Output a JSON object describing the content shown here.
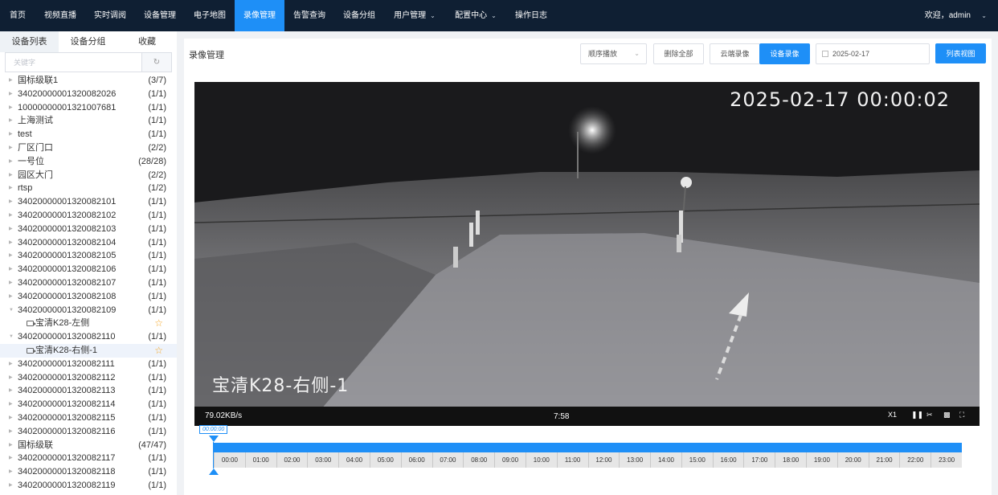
{
  "nav": {
    "items": [
      {
        "label": "首页",
        "active": false,
        "dropdown": false
      },
      {
        "label": "视频直播",
        "active": false,
        "dropdown": false
      },
      {
        "label": "实时调阅",
        "active": false,
        "dropdown": false
      },
      {
        "label": "设备管理",
        "active": false,
        "dropdown": false
      },
      {
        "label": "电子地图",
        "active": false,
        "dropdown": false
      },
      {
        "label": "录像管理",
        "active": true,
        "dropdown": false
      },
      {
        "label": "告警查询",
        "active": false,
        "dropdown": false
      },
      {
        "label": "设备分组",
        "active": false,
        "dropdown": false
      },
      {
        "label": "用户管理",
        "active": false,
        "dropdown": true
      },
      {
        "label": "配置中心",
        "active": false,
        "dropdown": true
      },
      {
        "label": "操作日志",
        "active": false,
        "dropdown": false
      }
    ],
    "welcome": "欢迎，admin"
  },
  "sidebar": {
    "tabs": [
      {
        "label": "设备列表",
        "active": true
      },
      {
        "label": "设备分组",
        "active": false
      },
      {
        "label": "收藏",
        "active": false
      }
    ],
    "search_placeholder": "关键字",
    "tree": [
      {
        "label": "国标级联1",
        "count": "(3/7)"
      },
      {
        "label": "34020000001320082026",
        "count": "(1/1)"
      },
      {
        "label": "10000000001321007681",
        "count": "(1/1)"
      },
      {
        "label": "上海测试",
        "count": "(1/1)"
      },
      {
        "label": "test",
        "count": "(1/1)"
      },
      {
        "label": "厂区门口",
        "count": "(2/2)"
      },
      {
        "label": "一号位",
        "count": "(28/28)"
      },
      {
        "label": "园区大门",
        "count": "(2/2)"
      },
      {
        "label": "rtsp",
        "count": "(1/2)"
      },
      {
        "label": "34020000001320082101",
        "count": "(1/1)"
      },
      {
        "label": "34020000001320082102",
        "count": "(1/1)"
      },
      {
        "label": "34020000001320082103",
        "count": "(1/1)"
      },
      {
        "label": "34020000001320082104",
        "count": "(1/1)"
      },
      {
        "label": "34020000001320082105",
        "count": "(1/1)"
      },
      {
        "label": "34020000001320082106",
        "count": "(1/1)"
      },
      {
        "label": "34020000001320082107",
        "count": "(1/1)"
      },
      {
        "label": "34020000001320082108",
        "count": "(1/1)"
      },
      {
        "label": "34020000001320082109",
        "count": "(1/1)",
        "expanded": true
      },
      {
        "label": "宝清K28-左侧",
        "child": true
      },
      {
        "label": "34020000001320082110",
        "count": "(1/1)",
        "expanded": true
      },
      {
        "label": "宝清K28-右侧-1",
        "child": true,
        "selected": true
      },
      {
        "label": "34020000001320082111",
        "count": "(1/1)"
      },
      {
        "label": "34020000001320082112",
        "count": "(1/1)"
      },
      {
        "label": "34020000001320082113",
        "count": "(1/1)"
      },
      {
        "label": "34020000001320082114",
        "count": "(1/1)"
      },
      {
        "label": "34020000001320082115",
        "count": "(1/1)"
      },
      {
        "label": "34020000001320082116",
        "count": "(1/1)"
      },
      {
        "label": "国标级联",
        "count": "(47/47)"
      },
      {
        "label": "34020000001320082117",
        "count": "(1/1)"
      },
      {
        "label": "34020000001320082118",
        "count": "(1/1)"
      },
      {
        "label": "34020000001320082119",
        "count": "(1/1)"
      }
    ]
  },
  "main": {
    "title": "录像管理",
    "play_mode": "顺序播放",
    "delete_all": "删除全部",
    "cloud_record": "云端录像",
    "device_record": "设备录像",
    "date": "2025-02-17",
    "list_view": "列表视图"
  },
  "player": {
    "timestamp": "2025-02-17 00:00:02",
    "camera_name": "宝清K28-右侧-1",
    "rate": "79.02KB/s",
    "elapsed": "7:58",
    "speed": "X1"
  },
  "timeline": {
    "marker": "00:00:00",
    "hours": [
      "00:00",
      "01:00",
      "02:00",
      "03:00",
      "04:00",
      "05:00",
      "06:00",
      "07:00",
      "08:00",
      "09:00",
      "10:00",
      "11:00",
      "12:00",
      "13:00",
      "14:00",
      "15:00",
      "16:00",
      "17:00",
      "18:00",
      "19:00",
      "20:00",
      "21:00",
      "22:00",
      "23:00"
    ],
    "recorded_fraction": 1.0
  },
  "colors": {
    "nav_bg": "#0f1f33",
    "accent": "#1e8ff7",
    "star": "#f5a623"
  },
  "icons": {
    "refresh": "refresh-icon",
    "calendar": "calendar-icon",
    "pause": "pause-icon",
    "scissors": "scissors-icon",
    "record": "video-record-icon",
    "fullscreen": "fullscreen-icon"
  }
}
